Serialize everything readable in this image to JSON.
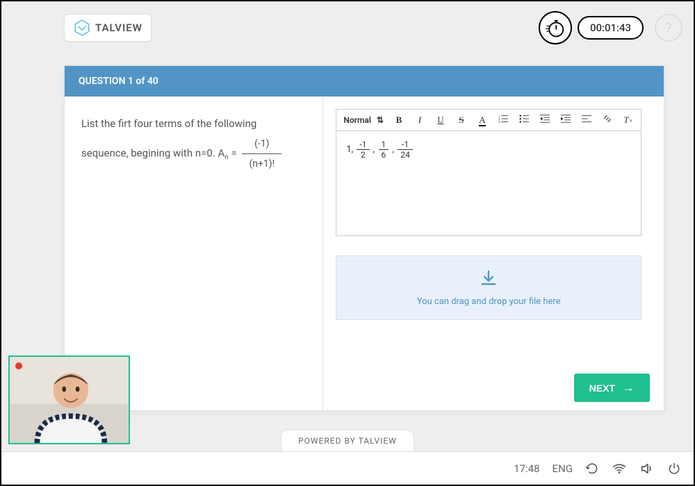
{
  "brand": {
    "name": "TALVIEW"
  },
  "timer": {
    "value": "00:01:43"
  },
  "question": {
    "header": "QUESTION 1 of 40",
    "prompt_prefix": "List the firt four terms of the following sequence, begining with n=0. A",
    "prompt_sub": "n",
    "prompt_eq": " = ",
    "frac_top": "(-1)",
    "frac_bot": "(n+1)!"
  },
  "editor": {
    "style_label": "Normal",
    "answer_prefix": "1,",
    "f1_top": "-1",
    "f1_bot": "2",
    "sep1": ", ",
    "f2_top": "1",
    "f2_bot": "6",
    "sep2": ", ",
    "f3_top": "-1",
    "f3_bot": "24"
  },
  "dropzone": {
    "text": "You can drag and drop your file here"
  },
  "next": {
    "label": "NEXT"
  },
  "powered": {
    "text": "POWERED BY TALVIEW"
  },
  "footer": {
    "time": "17:48",
    "lang": "ENG"
  }
}
